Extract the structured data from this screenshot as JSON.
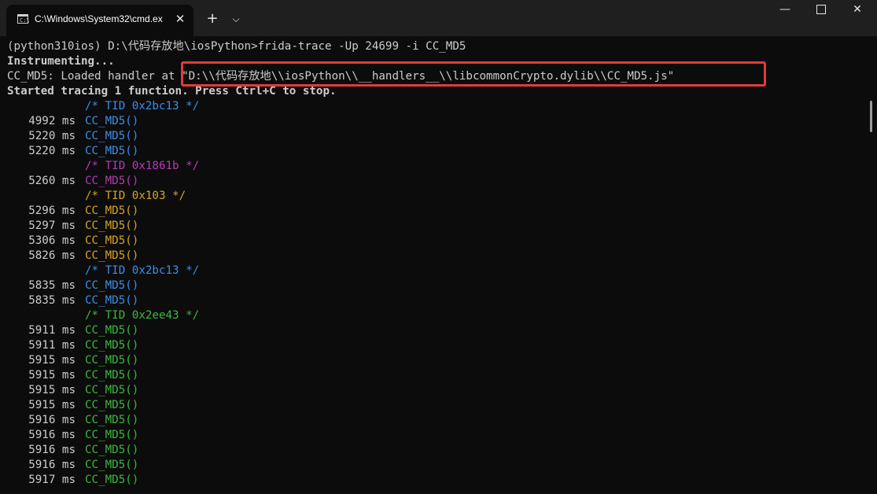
{
  "window": {
    "tab_title": "C:\\Windows\\System32\\cmd.ex",
    "tab_close": "✕",
    "new_tab": "+",
    "dropdown": "⌵",
    "minimize": "—",
    "close": "✕"
  },
  "terminal": {
    "cmd_line": "(python310ios) D:\\代码存放地\\iosPython>frida-trace -Up 24699 -i CC_MD5",
    "instrumenting": "Instrumenting...",
    "loaded_handler": "CC_MD5: Loaded handler at \"D:\\\\代码存放地\\\\iosPython\\\\__handlers__\\\\libcommonCrypto.dylib\\\\CC_MD5.js\"",
    "started": "Started tracing 1 function. Press Ctrl+C to stop.",
    "tids": [
      {
        "text": "/* TID 0x2bc13 */"
      },
      {
        "text": "/* TID 0x1861b */"
      },
      {
        "text": "/* TID 0x103 */"
      },
      {
        "text": "/* TID 0x2bc13 */"
      },
      {
        "text": "/* TID 0x2ee43 */"
      }
    ],
    "calls": [
      {
        "ms": "4992 ms",
        "fn": "CC_MD5()"
      },
      {
        "ms": "5220 ms",
        "fn": "CC_MD5()"
      },
      {
        "ms": "5220 ms",
        "fn": "CC_MD5()"
      },
      {
        "ms": "5260 ms",
        "fn": "CC_MD5()"
      },
      {
        "ms": "5296 ms",
        "fn": "CC_MD5()"
      },
      {
        "ms": "5297 ms",
        "fn": "CC_MD5()"
      },
      {
        "ms": "5306 ms",
        "fn": "CC_MD5()"
      },
      {
        "ms": "5826 ms",
        "fn": "CC_MD5()"
      },
      {
        "ms": "5835 ms",
        "fn": "CC_MD5()"
      },
      {
        "ms": "5835 ms",
        "fn": "CC_MD5()"
      },
      {
        "ms": "5911 ms",
        "fn": "CC_MD5()"
      },
      {
        "ms": "5911 ms",
        "fn": "CC_MD5()"
      },
      {
        "ms": "5915 ms",
        "fn": "CC_MD5()"
      },
      {
        "ms": "5915 ms",
        "fn": "CC_MD5()"
      },
      {
        "ms": "5915 ms",
        "fn": "CC_MD5()"
      },
      {
        "ms": "5915 ms",
        "fn": "CC_MD5()"
      },
      {
        "ms": "5916 ms",
        "fn": "CC_MD5()"
      },
      {
        "ms": "5916 ms",
        "fn": "CC_MD5()"
      },
      {
        "ms": "5916 ms",
        "fn": "CC_MD5()"
      },
      {
        "ms": "5916 ms",
        "fn": "CC_MD5()"
      },
      {
        "ms": "5917 ms",
        "fn": "CC_MD5()"
      }
    ]
  },
  "colors": {
    "blue": "#3b8eea",
    "purple": "#b73ab7",
    "gold": "#d7a424",
    "green": "#3cb83c",
    "highlight": "#e23b3b"
  }
}
